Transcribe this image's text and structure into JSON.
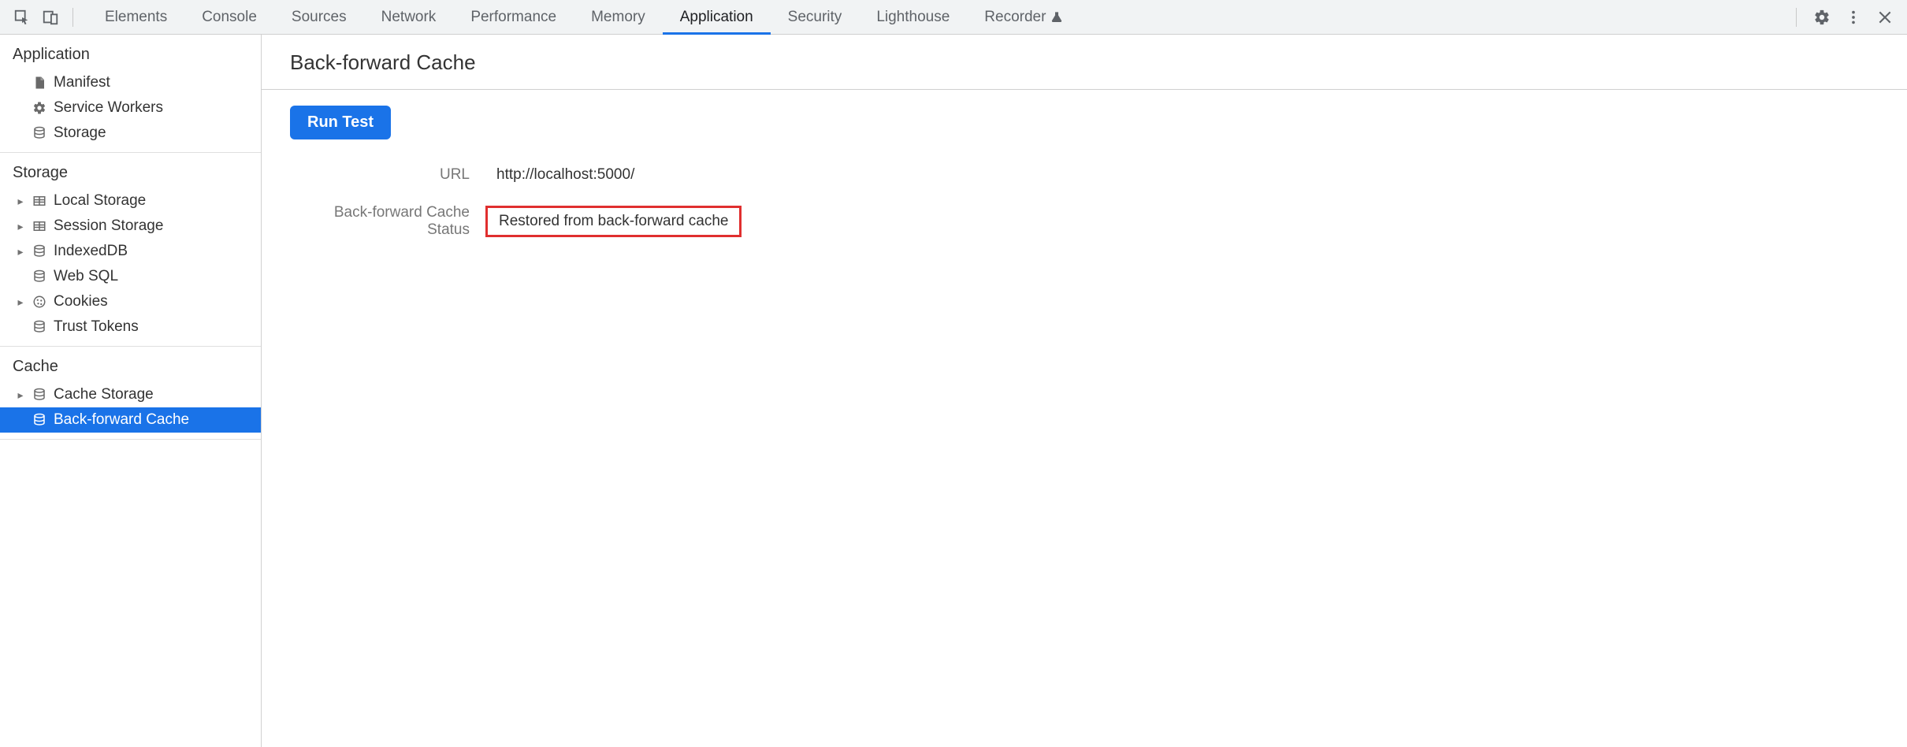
{
  "toolbar": {
    "tabs": [
      {
        "label": "Elements",
        "active": false
      },
      {
        "label": "Console",
        "active": false
      },
      {
        "label": "Sources",
        "active": false
      },
      {
        "label": "Network",
        "active": false
      },
      {
        "label": "Performance",
        "active": false
      },
      {
        "label": "Memory",
        "active": false
      },
      {
        "label": "Application",
        "active": true
      },
      {
        "label": "Security",
        "active": false
      },
      {
        "label": "Lighthouse",
        "active": false
      },
      {
        "label": "Recorder",
        "active": false,
        "has_flask": true
      }
    ]
  },
  "sidebar": {
    "sections": [
      {
        "title": "Application",
        "items": [
          {
            "label": "Manifest",
            "icon": "file",
            "expandable": false
          },
          {
            "label": "Service Workers",
            "icon": "gear",
            "expandable": false
          },
          {
            "label": "Storage",
            "icon": "db",
            "expandable": false
          }
        ]
      },
      {
        "title": "Storage",
        "items": [
          {
            "label": "Local Storage",
            "icon": "table",
            "expandable": true
          },
          {
            "label": "Session Storage",
            "icon": "table",
            "expandable": true
          },
          {
            "label": "IndexedDB",
            "icon": "db",
            "expandable": true
          },
          {
            "label": "Web SQL",
            "icon": "db",
            "expandable": false
          },
          {
            "label": "Cookies",
            "icon": "cookie",
            "expandable": true
          },
          {
            "label": "Trust Tokens",
            "icon": "db",
            "expandable": false
          }
        ]
      },
      {
        "title": "Cache",
        "items": [
          {
            "label": "Cache Storage",
            "icon": "db",
            "expandable": true
          },
          {
            "label": "Back-forward Cache",
            "icon": "db",
            "expandable": false,
            "selected": true
          }
        ]
      }
    ]
  },
  "content": {
    "title": "Back-forward Cache",
    "run_button": "Run Test",
    "rows": [
      {
        "label": "URL",
        "value": "http://localhost:5000/",
        "highlight": false
      },
      {
        "label": "Back-forward Cache Status",
        "value": "Restored from back-forward cache",
        "highlight": true
      }
    ]
  }
}
